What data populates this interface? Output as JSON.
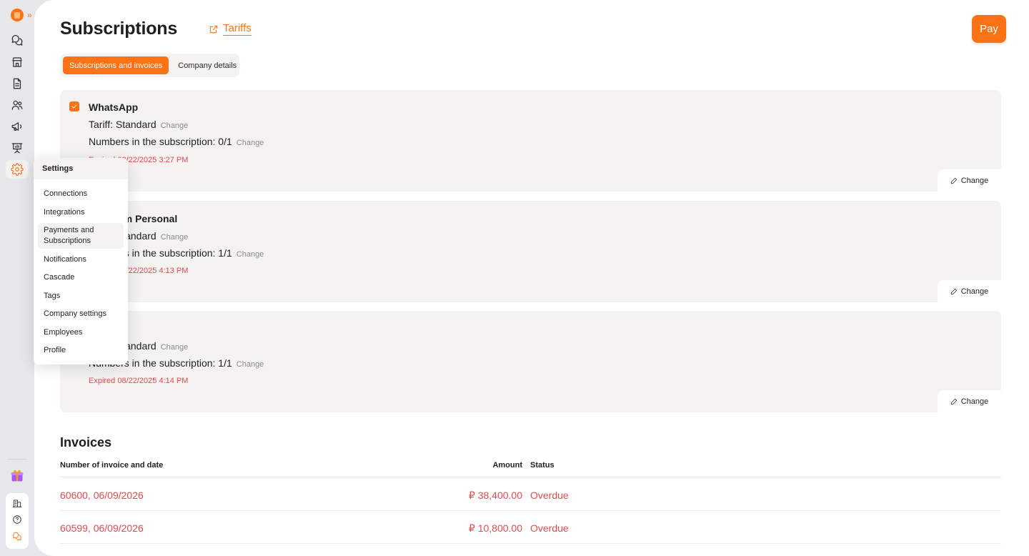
{
  "header": {
    "title": "Subscriptions",
    "tariffs_link": "Tariffs",
    "pay_button": "Pay"
  },
  "tabs": [
    {
      "label": "Subscriptions and invoices",
      "active": true
    },
    {
      "label": "Company details",
      "active": false
    }
  ],
  "subscriptions": [
    {
      "title": "WhatsApp",
      "checked": true,
      "tariff": "Tariff: Standard",
      "tariff_change": "Change",
      "numbers": "Numbers in the subscription: 0/1",
      "numbers_change": "Change",
      "expired": "Expired 08/22/2025 3:27 PM",
      "change_button": "Change"
    },
    {
      "title": "Telegram Personal",
      "tariff": "Tariff: Standard",
      "tariff_change": "Change",
      "numbers": "Numbers in the subscription: 1/1",
      "numbers_change": "Change",
      "expired": "Expired 08/22/2025 4:13 PM",
      "change_button": "Change"
    },
    {
      "title": "",
      "tariff": "Tariff: Standard",
      "tariff_change": "Change",
      "numbers": "Numbers in the subscription: 1/1",
      "numbers_change": "Change",
      "expired": "Expired 08/22/2025 4:14 PM",
      "change_button": "Change"
    }
  ],
  "invoices": {
    "title": "Invoices",
    "columns": [
      "Number of invoice and date",
      "Amount",
      "Status"
    ],
    "rows": [
      {
        "number": "60600, 06/09/2026",
        "amount": "₽ 38,400.00",
        "status": "Overdue"
      },
      {
        "number": "60599, 06/09/2026",
        "amount": "₽ 10,800.00",
        "status": "Overdue"
      }
    ]
  },
  "settings_menu": {
    "title": "Settings",
    "items": [
      {
        "label": "Connections"
      },
      {
        "label": "Integrations"
      },
      {
        "label": "Payments and Subscriptions",
        "active": true
      },
      {
        "label": "Notifications"
      },
      {
        "label": "Cascade"
      },
      {
        "label": "Tags"
      },
      {
        "label": "Company settings"
      },
      {
        "label": "Employees"
      },
      {
        "label": "Profile"
      }
    ]
  },
  "colors": {
    "accent": "#f97316",
    "danger": "#e5484d",
    "card_bg": "#f4f3f2"
  },
  "icons": {
    "rail": [
      "chats-icon",
      "store-icon",
      "document-icon",
      "contacts-icon",
      "megaphone-icon",
      "presentation-icon",
      "gear-icon"
    ],
    "bottom": [
      "building-icon",
      "help-icon",
      "chat-support-icon"
    ]
  }
}
